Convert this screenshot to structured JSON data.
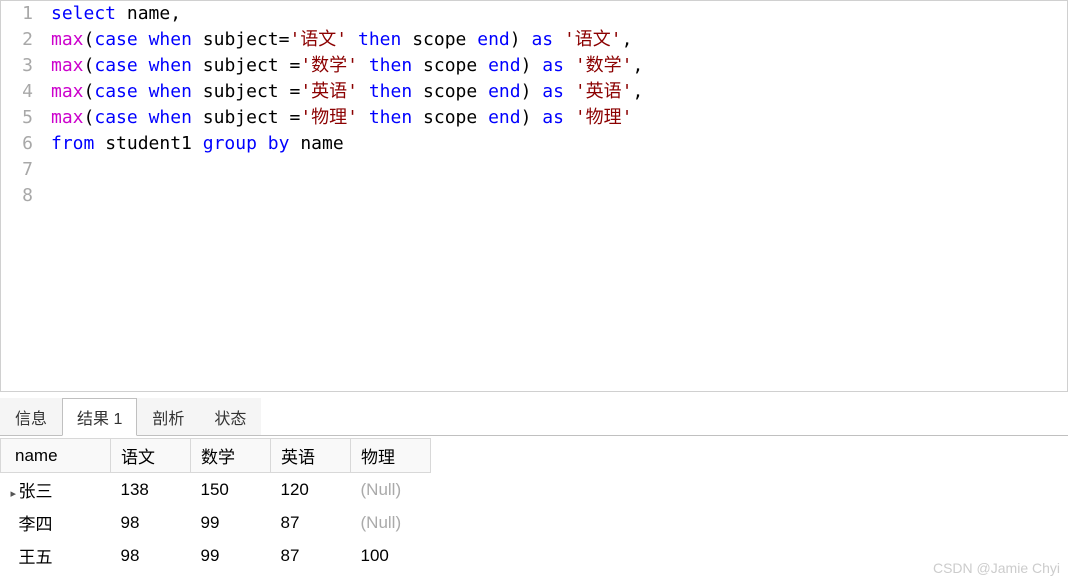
{
  "editor": {
    "lines": [
      {
        "num": "1",
        "tokens": [
          {
            "t": "select",
            "c": "sel"
          },
          {
            "t": " ",
            "c": ""
          },
          {
            "t": "name",
            "c": "ident"
          },
          {
            "t": ",",
            "c": "ident"
          }
        ]
      },
      {
        "num": "2",
        "tokens": [
          {
            "t": "max",
            "c": "fn"
          },
          {
            "t": "(",
            "c": "ident"
          },
          {
            "t": "case",
            "c": "kw"
          },
          {
            "t": " ",
            "c": ""
          },
          {
            "t": "when",
            "c": "kw"
          },
          {
            "t": " ",
            "c": ""
          },
          {
            "t": "subject=",
            "c": "ident"
          },
          {
            "t": "'语文'",
            "c": "str"
          },
          {
            "t": " ",
            "c": ""
          },
          {
            "t": "then",
            "c": "kw"
          },
          {
            "t": " ",
            "c": ""
          },
          {
            "t": "scope",
            "c": "ident"
          },
          {
            "t": " ",
            "c": ""
          },
          {
            "t": "end",
            "c": "kw"
          },
          {
            "t": ") ",
            "c": "ident"
          },
          {
            "t": "as",
            "c": "kw"
          },
          {
            "t": " ",
            "c": ""
          },
          {
            "t": "'语文'",
            "c": "str"
          },
          {
            "t": ",",
            "c": "ident"
          }
        ]
      },
      {
        "num": "3",
        "tokens": [
          {
            "t": "max",
            "c": "fn"
          },
          {
            "t": "(",
            "c": "ident"
          },
          {
            "t": "case",
            "c": "kw"
          },
          {
            "t": " ",
            "c": ""
          },
          {
            "t": "when",
            "c": "kw"
          },
          {
            "t": " ",
            "c": ""
          },
          {
            "t": "subject =",
            "c": "ident"
          },
          {
            "t": "'数学'",
            "c": "str"
          },
          {
            "t": " ",
            "c": ""
          },
          {
            "t": "then",
            "c": "kw"
          },
          {
            "t": " ",
            "c": ""
          },
          {
            "t": "scope",
            "c": "ident"
          },
          {
            "t": " ",
            "c": ""
          },
          {
            "t": "end",
            "c": "kw"
          },
          {
            "t": ") ",
            "c": "ident"
          },
          {
            "t": "as",
            "c": "kw"
          },
          {
            "t": " ",
            "c": ""
          },
          {
            "t": "'数学'",
            "c": "str"
          },
          {
            "t": ",",
            "c": "ident"
          }
        ]
      },
      {
        "num": "4",
        "tokens": [
          {
            "t": "max",
            "c": "fn"
          },
          {
            "t": "(",
            "c": "ident"
          },
          {
            "t": "case",
            "c": "kw"
          },
          {
            "t": " ",
            "c": ""
          },
          {
            "t": "when",
            "c": "kw"
          },
          {
            "t": " ",
            "c": ""
          },
          {
            "t": "subject =",
            "c": "ident"
          },
          {
            "t": "'英语'",
            "c": "str"
          },
          {
            "t": " ",
            "c": ""
          },
          {
            "t": "then",
            "c": "kw"
          },
          {
            "t": " ",
            "c": ""
          },
          {
            "t": "scope",
            "c": "ident"
          },
          {
            "t": " ",
            "c": ""
          },
          {
            "t": "end",
            "c": "kw"
          },
          {
            "t": ") ",
            "c": "ident"
          },
          {
            "t": "as",
            "c": "kw"
          },
          {
            "t": " ",
            "c": ""
          },
          {
            "t": "'英语'",
            "c": "str"
          },
          {
            "t": ",",
            "c": "ident"
          }
        ]
      },
      {
        "num": "5",
        "tokens": [
          {
            "t": "max",
            "c": "fn"
          },
          {
            "t": "(",
            "c": "ident"
          },
          {
            "t": "case",
            "c": "kw"
          },
          {
            "t": " ",
            "c": ""
          },
          {
            "t": "when",
            "c": "kw"
          },
          {
            "t": " ",
            "c": ""
          },
          {
            "t": "subject =",
            "c": "ident"
          },
          {
            "t": "'物理'",
            "c": "str"
          },
          {
            "t": " ",
            "c": ""
          },
          {
            "t": "then",
            "c": "kw"
          },
          {
            "t": " ",
            "c": ""
          },
          {
            "t": "scope",
            "c": "ident"
          },
          {
            "t": " ",
            "c": ""
          },
          {
            "t": "end",
            "c": "kw"
          },
          {
            "t": ") ",
            "c": "ident"
          },
          {
            "t": "as",
            "c": "kw"
          },
          {
            "t": " ",
            "c": ""
          },
          {
            "t": "'物理'",
            "c": "str"
          }
        ]
      },
      {
        "num": "6",
        "tokens": [
          {
            "t": "from",
            "c": "kw"
          },
          {
            "t": " ",
            "c": ""
          },
          {
            "t": "student1",
            "c": "ident"
          },
          {
            "t": " ",
            "c": ""
          },
          {
            "t": "group",
            "c": "kw"
          },
          {
            "t": " ",
            "c": ""
          },
          {
            "t": "by",
            "c": "kw"
          },
          {
            "t": " ",
            "c": ""
          },
          {
            "t": "name",
            "c": "ident"
          }
        ]
      },
      {
        "num": "7",
        "tokens": []
      },
      {
        "num": "8",
        "tokens": []
      }
    ]
  },
  "tabs": {
    "items": [
      {
        "label": "信息",
        "active": false
      },
      {
        "label": "结果 1",
        "active": true
      },
      {
        "label": "剖析",
        "active": false
      },
      {
        "label": "状态",
        "active": false
      }
    ]
  },
  "result": {
    "headers": [
      "name",
      "语文",
      "数学",
      "英语",
      "物理"
    ],
    "rows": [
      {
        "marker": "▸",
        "cells": [
          "张三",
          "138",
          "150",
          "120",
          "(Null)"
        ]
      },
      {
        "marker": "",
        "cells": [
          "李四",
          "98",
          "99",
          "87",
          "(Null)"
        ]
      },
      {
        "marker": "",
        "cells": [
          "王五",
          "98",
          "99",
          "87",
          "100"
        ]
      }
    ]
  },
  "watermark": "CSDN @Jamie Chyi"
}
